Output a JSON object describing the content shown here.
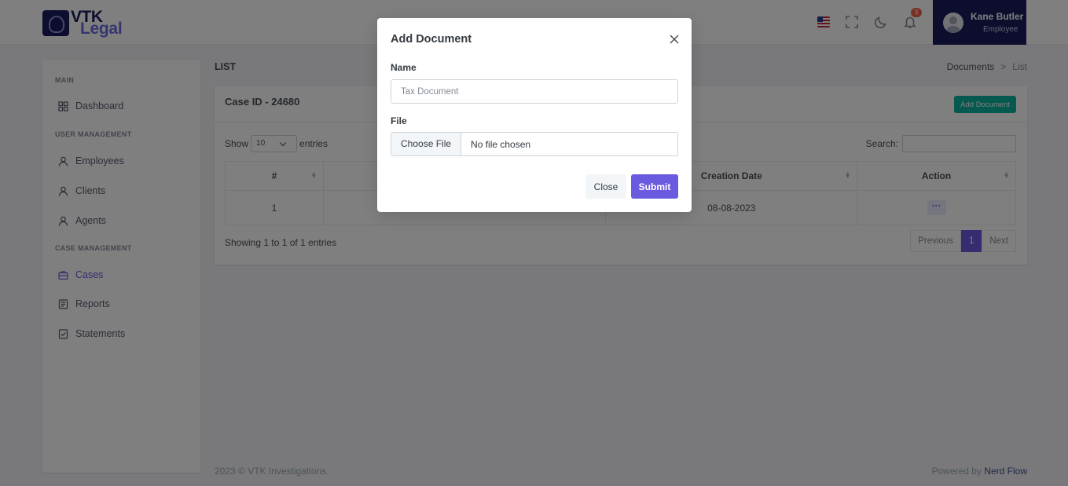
{
  "brand": {
    "line1": "VTK",
    "line2": "Legal"
  },
  "header": {
    "notification_count": "3",
    "user_name": "Kane Butler",
    "user_role": "Employee"
  },
  "sidebar": {
    "sections": [
      {
        "title": "MAIN"
      },
      {
        "title": "USER MANAGEMENT"
      },
      {
        "title": "CASE MANAGEMENT"
      }
    ],
    "items": [
      {
        "label": "Dashboard",
        "icon": "dashboard-icon"
      },
      {
        "label": "Employees",
        "icon": "user-icon"
      },
      {
        "label": "Clients",
        "icon": "user-icon"
      },
      {
        "label": "Agents",
        "icon": "user-icon"
      },
      {
        "label": "Cases",
        "icon": "briefcase-icon",
        "active": true
      },
      {
        "label": "Reports",
        "icon": "report-icon"
      },
      {
        "label": "Statements",
        "icon": "statement-icon"
      }
    ]
  },
  "page": {
    "title": "LIST",
    "breadcrumb": {
      "parent": "Documents",
      "sep": ">",
      "current": "List"
    },
    "case_id": "Case ID - 24680",
    "add_button": "Add Document",
    "show_label": "Show",
    "entries_value": "10",
    "entries_label": "entries",
    "search_label": "Search:",
    "table": {
      "headers": [
        "#",
        "",
        "Creation Date",
        "Action"
      ],
      "rows": [
        {
          "index": "1",
          "col2": "",
          "date": "08-08-2023",
          "action": "···"
        }
      ]
    },
    "showing": "Showing 1 to 1 of 1 entries",
    "pagination": {
      "prev": "Previous",
      "current": "1",
      "next": "Next"
    }
  },
  "footer": {
    "copyright": "2023 © VTK Investigations.",
    "powered_prefix": "Powered by",
    "powered_link": "Nerd Flow"
  },
  "modal": {
    "title": "Add Document",
    "name_label": "Name",
    "name_placeholder": "Tax Document",
    "file_label": "File",
    "choose_file": "Choose File",
    "no_file": "No file chosen",
    "close_button": "Close",
    "submit_button": "Submit"
  },
  "colors": {
    "primary": "#6a5ae0",
    "success": "#0ab39c",
    "brand_dark": "#1a1d5c",
    "badge": "#f06548"
  }
}
